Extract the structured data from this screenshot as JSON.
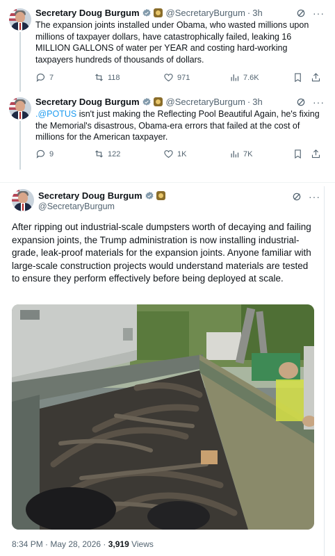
{
  "tweets": [
    {
      "name": "Secretary Doug Burgum",
      "handle": "@SecretaryBurgum",
      "time": "3h",
      "text": "The expansion joints installed under Obama, who wasted millions upon millions of taxpayer dollars, have catastrophically failed, leaking 16 MILLION GALLONS of water per YEAR and costing hard-working taxpayers hundreds of thousands of dollars.",
      "replies": "7",
      "reposts": "118",
      "likes": "971",
      "views": "7.6K"
    },
    {
      "name": "Secretary Doug Burgum",
      "handle": "@SecretaryBurgum",
      "time": "3h",
      "mention": ".@POTUS",
      "text": " isn't just making the Reflecting Pool Beautiful Again, he's fixing the Memorial's disastrous, Obama-era errors that failed at the cost of millions for the American taxpayer.",
      "replies": "9",
      "reposts": "122",
      "likes": "1K",
      "views": "7K"
    }
  ],
  "main_tweet": {
    "name": "Secretary Doug Burgum",
    "handle": "@SecretaryBurgum",
    "text": "After ripping out industrial-scale dumpsters worth of decaying and failing expansion joints, the Trump administration is now installing industrial-grade, leak-proof materials for the expansion joints. Anyone familiar with large-scale construction projects would understand materials are tested to ensure they perform effectively before being deployed at scale.",
    "timestamp": "8:34 PM · May 28, 2026 · ",
    "view_count": "3,919",
    "views_label": " Views"
  },
  "icons": {
    "verified": "verified-badge-icon",
    "grok": "grok-icon",
    "more": "more-icon",
    "reply": "reply-icon",
    "repost": "repost-icon",
    "like": "like-icon",
    "views": "views-icon",
    "bookmark": "bookmark-icon",
    "share": "share-icon"
  },
  "colors": {
    "accent": "#1d9bf0",
    "secondary_text": "#536471",
    "primary_text": "#0f1419"
  }
}
